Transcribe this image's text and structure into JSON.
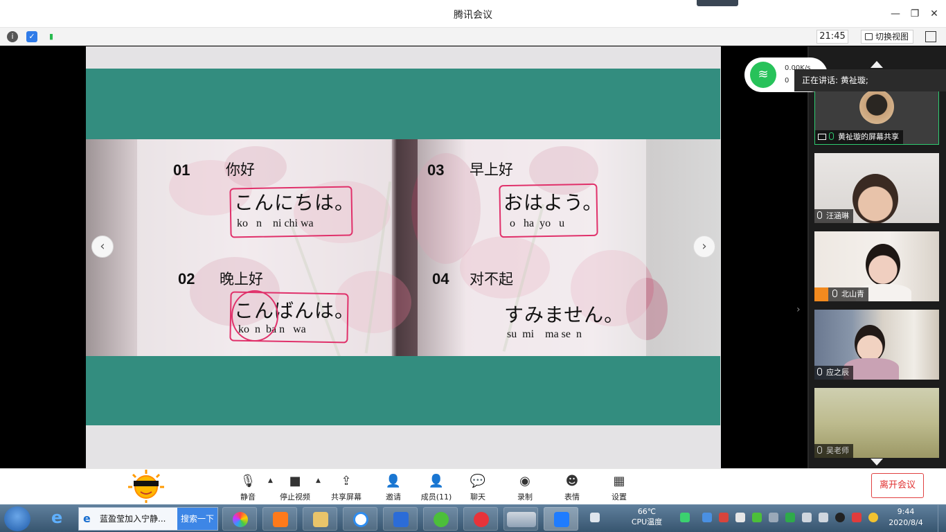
{
  "window": {
    "title": "腾讯会议"
  },
  "infobar": {
    "time": "21:45",
    "switch_view": "切换视图"
  },
  "slide": {
    "items": [
      {
        "num": "01",
        "cn": "你好",
        "jp": "こんにちは。",
        "ro": "ko   n    ni chi wa"
      },
      {
        "num": "02",
        "cn": "晚上好",
        "jp": "こんばんは。",
        "ro": "ko  n  ba n   wa"
      },
      {
        "num": "03",
        "cn": "早上好",
        "jp": "おはよう。",
        "ro": "o   ha  yo   u"
      },
      {
        "num": "04",
        "cn": "对不起",
        "jp": "すみません。",
        "ro": "su  mi    ma se  n"
      }
    ]
  },
  "speaking": {
    "text": "正在讲话: 黄祉璇;"
  },
  "network": {
    "down": "0.00K/s",
    "up": "0"
  },
  "participants": [
    {
      "name": "黄祉璇的屏幕共享"
    },
    {
      "name": "汪涵琳"
    },
    {
      "name": "北山青"
    },
    {
      "name": "应之辰"
    },
    {
      "name": "吴老师"
    }
  ],
  "toolbar": {
    "mute": "静音",
    "stop_video": "停止视频",
    "share_screen": "共享屏幕",
    "invite": "邀请",
    "members": "成员(11)",
    "chat": "聊天",
    "record": "录制",
    "reactions": "表情",
    "settings": "设置",
    "leave": "离开会议"
  },
  "taskbar": {
    "search_text": "蓝盈莹加入宁静...",
    "search_button": "搜索一下",
    "cpu_temp": "66℃",
    "cpu_label": "CPU温度",
    "time": "9:44",
    "date": "2020/8/4"
  },
  "colors": {
    "band": "#338d7f",
    "ink": "#e0306a",
    "leave": "#e03030"
  }
}
